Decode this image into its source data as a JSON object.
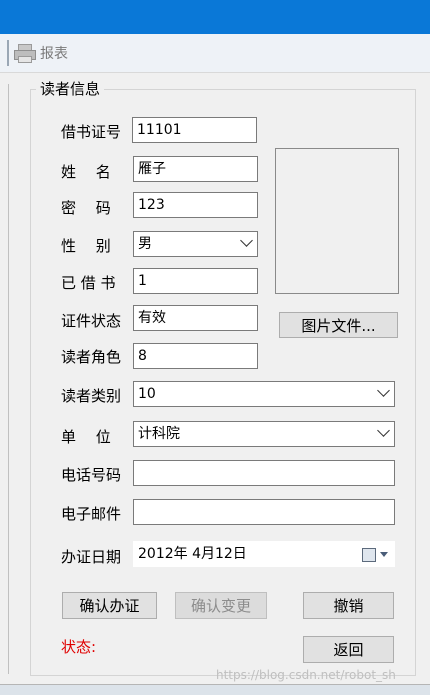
{
  "toolbar": {
    "report_label": "报表"
  },
  "group": {
    "title": "读者信息"
  },
  "labels": {
    "card_no": "借书证号",
    "name": "姓　 名",
    "password": "密　 码",
    "gender": "性　 别",
    "borrowed": "已 借 书",
    "card_status": "证件状态",
    "reader_role": "读者角色",
    "reader_type": "读者类别",
    "unit": "单　 位",
    "phone": "电话号码",
    "email": "电子邮件",
    "issue_date": "办证日期"
  },
  "fields": {
    "card_no": "11101",
    "name": "雁子",
    "password": "123",
    "gender": "男",
    "borrowed": "1",
    "card_status": "有效",
    "reader_role": "8",
    "reader_type": "10",
    "unit": "计科院",
    "phone": "",
    "email": "",
    "issue_date": "2012年 4月12日"
  },
  "buttons": {
    "image_file": "图片文件...",
    "confirm_issue": "确认办证",
    "confirm_change": "确认变更",
    "cancel": "撤销",
    "back": "返回"
  },
  "status": {
    "label": "状态:"
  },
  "watermark": "https://blog.csdn.net/robot_sh",
  "colors": {
    "titlebar": "#0a78d7",
    "status_text": "#e00000"
  }
}
